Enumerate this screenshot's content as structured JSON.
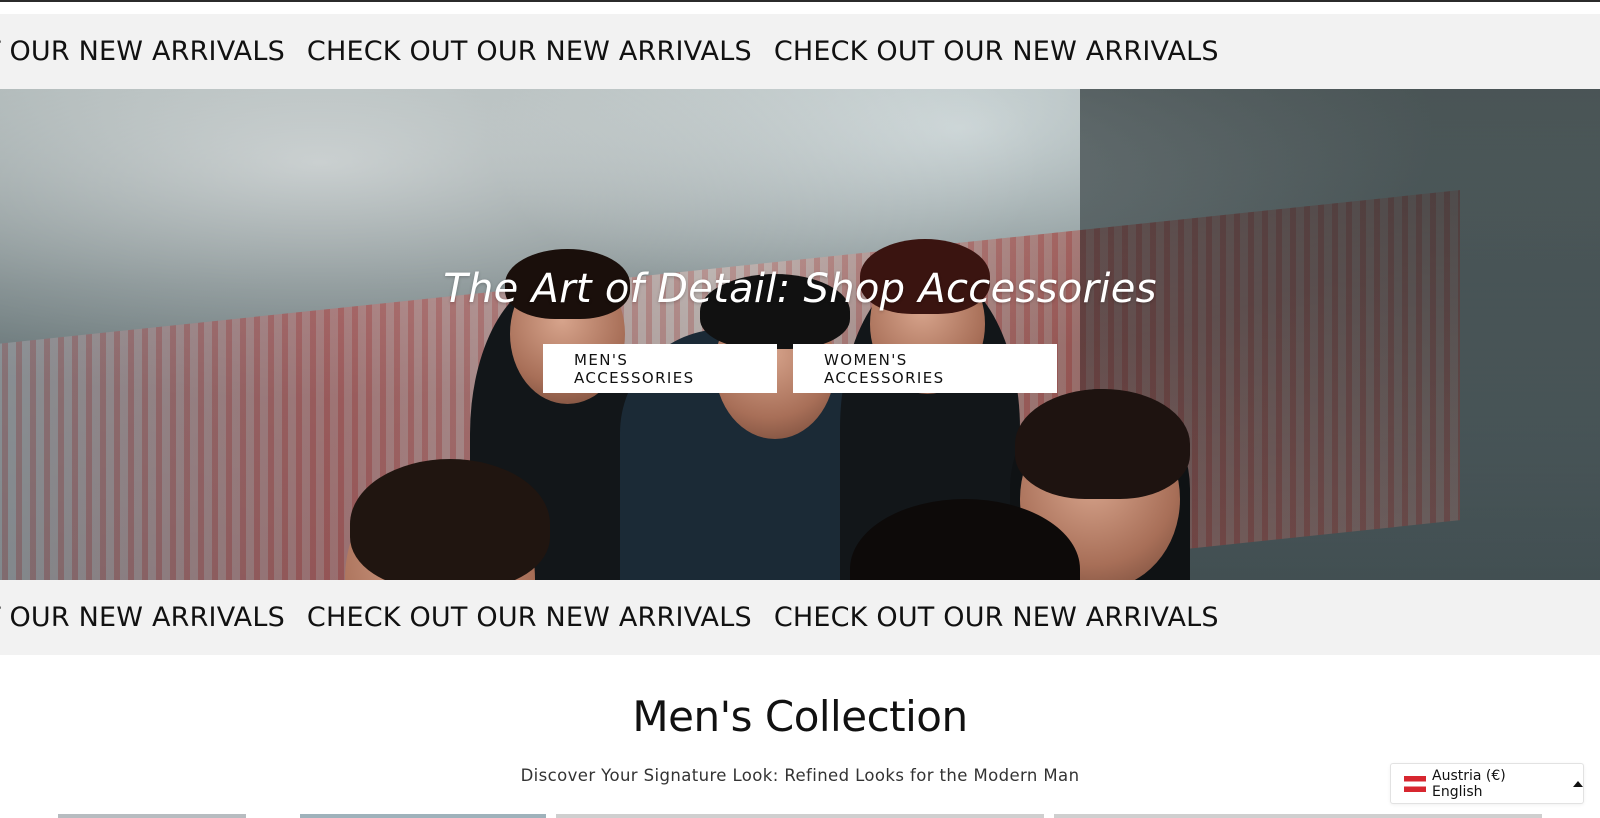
{
  "announcement_bar": {
    "text": "CHECK OUT OUR NEW ARRIVALS",
    "first_visible_fragment": "T OUR NEW ARRIVALS"
  },
  "hero": {
    "title": "The Art of Detail: Shop Accessories",
    "buttons": [
      {
        "label": "MEN'S ACCESSORIES"
      },
      {
        "label": "WOMEN'S ACCESSORIES"
      }
    ]
  },
  "collection": {
    "title": "Men's Collection",
    "subtitle": "Discover Your Signature Look: Refined Looks for the Modern Man"
  },
  "locale_selector": {
    "label": "Austria (€) English",
    "flag_icon": "austria-flag-icon",
    "caret_icon": "caret-up-icon"
  },
  "colors": {
    "marquee_bg": "#f2f2f2",
    "button_bg": "#ffffff",
    "text": "#111111"
  }
}
